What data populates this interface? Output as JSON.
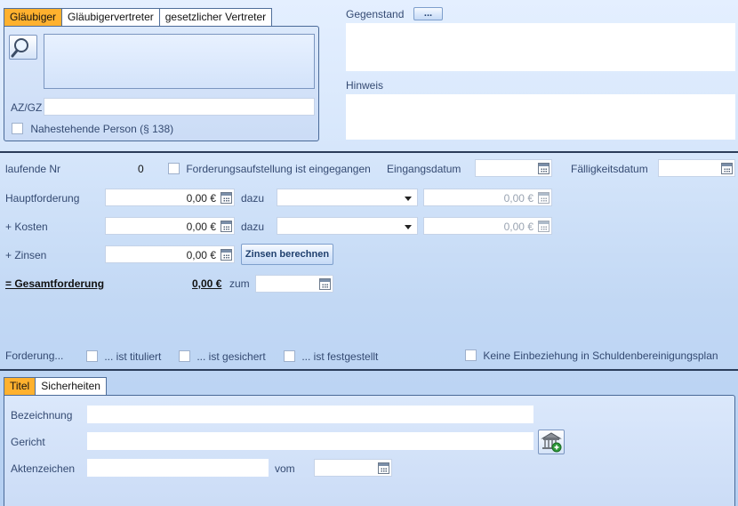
{
  "creditor_tabs": [
    "Gläubiger",
    "Gläubigervertreter",
    "gesetzlicher Vertreter"
  ],
  "creditor_panel": {
    "az_label": "AZ/GZ",
    "related_person_label": "Nahestehende Person (§ 138)"
  },
  "subject": {
    "label": "Gegenstand",
    "button": "...",
    "hint_label": "Hinweis"
  },
  "row_number": {
    "label": "laufende Nr",
    "value": "0",
    "received_checkbox": "Forderungsaufstellung ist eingegangen",
    "received_date_label": "Eingangsdatum",
    "due_date_label": "Fälligkeitsdatum"
  },
  "claims": {
    "main_label": "Hauptforderung",
    "main_value": "0,00 €",
    "costs_label": "+ Kosten",
    "costs_value": "0,00 €",
    "interest_label": "+ Zinsen",
    "interest_value": "0,00 €",
    "dazu_label": "dazu",
    "extra_main_value": "0,00 €",
    "extra_costs_value": "0,00 €",
    "interest_button": "Zinsen berechnen",
    "total_label": "= Gesamtforderung",
    "total_value": "0,00 €",
    "total_date_label": "zum"
  },
  "claim_flags": {
    "label": "Forderung...",
    "titled": "... ist tituliert",
    "secured": "... ist gesichert",
    "established": "... ist festgestellt",
    "exclude": "Keine Einbeziehung in Schuldenbereinigungsplan"
  },
  "title_tabs": [
    "Titel",
    "Sicherheiten"
  ],
  "title_panel": {
    "designation_label": "Bezeichnung",
    "court_label": "Gericht",
    "file_number_label": "Aktenzeichen",
    "date_label": "vom"
  },
  "colors": {
    "active_tab": "#ffb12e",
    "panel_border": "#4a6a98",
    "separator": "#2b3d5a"
  },
  "icons": {
    "search": "magnifier-icon",
    "calendar": "calendar-icon",
    "court_add": "court-add-icon"
  }
}
